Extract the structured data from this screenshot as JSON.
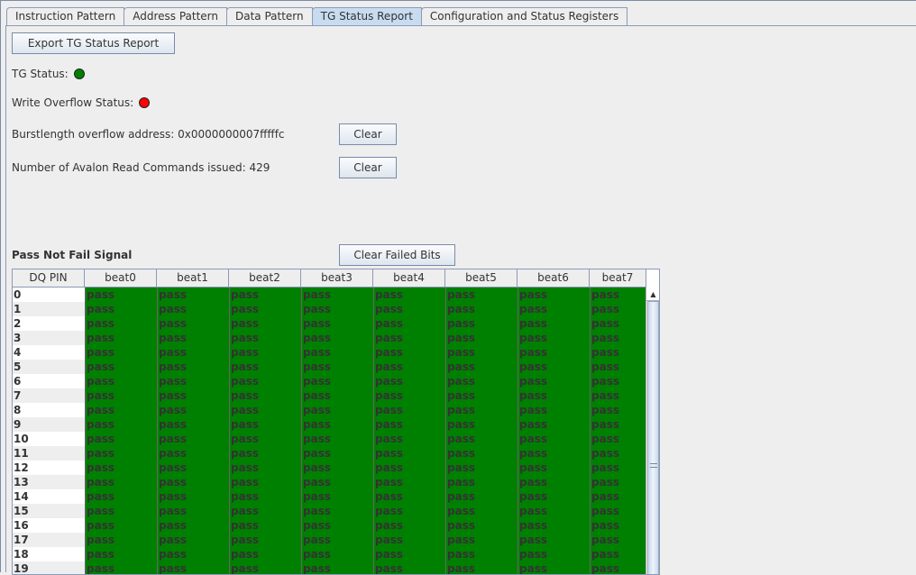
{
  "tabs": [
    {
      "label": "Instruction Pattern"
    },
    {
      "label": "Address Pattern"
    },
    {
      "label": "Data Pattern"
    },
    {
      "label": "TG Status Report",
      "active": true
    },
    {
      "label": "Configuration and Status Registers"
    }
  ],
  "export_button": "Export TG Status Report",
  "tg_status": {
    "label": "TG Status:",
    "color": "#008000"
  },
  "write_overflow": {
    "label": "Write Overflow Status:",
    "color": "#ff0000"
  },
  "burst_overflow": {
    "label": "Burstlength overflow address: 0x0000000007fffffc",
    "clear": "Clear"
  },
  "read_commands": {
    "label": "Number of Avalon Read Commands issued: 429",
    "clear": "Clear"
  },
  "pnf": {
    "title": "Pass Not Fail Signal",
    "clear_button": "Clear Failed Bits"
  },
  "table": {
    "columns": [
      "DQ PIN",
      "beat0",
      "beat1",
      "beat2",
      "beat3",
      "beat4",
      "beat5",
      "beat6",
      "beat7"
    ],
    "pass_color": "#008000",
    "rows": [
      {
        "pin": "0",
        "cells": [
          "pass",
          "pass",
          "pass",
          "pass",
          "pass",
          "pass",
          "pass",
          "pass"
        ]
      },
      {
        "pin": "1",
        "cells": [
          "pass",
          "pass",
          "pass",
          "pass",
          "pass",
          "pass",
          "pass",
          "pass"
        ]
      },
      {
        "pin": "2",
        "cells": [
          "pass",
          "pass",
          "pass",
          "pass",
          "pass",
          "pass",
          "pass",
          "pass"
        ]
      },
      {
        "pin": "3",
        "cells": [
          "pass",
          "pass",
          "pass",
          "pass",
          "pass",
          "pass",
          "pass",
          "pass"
        ]
      },
      {
        "pin": "4",
        "cells": [
          "pass",
          "pass",
          "pass",
          "pass",
          "pass",
          "pass",
          "pass",
          "pass"
        ]
      },
      {
        "pin": "5",
        "cells": [
          "pass",
          "pass",
          "pass",
          "pass",
          "pass",
          "pass",
          "pass",
          "pass"
        ]
      },
      {
        "pin": "6",
        "cells": [
          "pass",
          "pass",
          "pass",
          "pass",
          "pass",
          "pass",
          "pass",
          "pass"
        ]
      },
      {
        "pin": "7",
        "cells": [
          "pass",
          "pass",
          "pass",
          "pass",
          "pass",
          "pass",
          "pass",
          "pass"
        ]
      },
      {
        "pin": "8",
        "cells": [
          "pass",
          "pass",
          "pass",
          "pass",
          "pass",
          "pass",
          "pass",
          "pass"
        ]
      },
      {
        "pin": "9",
        "cells": [
          "pass",
          "pass",
          "pass",
          "pass",
          "pass",
          "pass",
          "pass",
          "pass"
        ]
      },
      {
        "pin": "10",
        "cells": [
          "pass",
          "pass",
          "pass",
          "pass",
          "pass",
          "pass",
          "pass",
          "pass"
        ]
      },
      {
        "pin": "11",
        "cells": [
          "pass",
          "pass",
          "pass",
          "pass",
          "pass",
          "pass",
          "pass",
          "pass"
        ]
      },
      {
        "pin": "12",
        "cells": [
          "pass",
          "pass",
          "pass",
          "pass",
          "pass",
          "pass",
          "pass",
          "pass"
        ]
      },
      {
        "pin": "13",
        "cells": [
          "pass",
          "pass",
          "pass",
          "pass",
          "pass",
          "pass",
          "pass",
          "pass"
        ]
      },
      {
        "pin": "14",
        "cells": [
          "pass",
          "pass",
          "pass",
          "pass",
          "pass",
          "pass",
          "pass",
          "pass"
        ]
      },
      {
        "pin": "15",
        "cells": [
          "pass",
          "pass",
          "pass",
          "pass",
          "pass",
          "pass",
          "pass",
          "pass"
        ]
      },
      {
        "pin": "16",
        "cells": [
          "pass",
          "pass",
          "pass",
          "pass",
          "pass",
          "pass",
          "pass",
          "pass"
        ]
      },
      {
        "pin": "17",
        "cells": [
          "pass",
          "pass",
          "pass",
          "pass",
          "pass",
          "pass",
          "pass",
          "pass"
        ]
      },
      {
        "pin": "18",
        "cells": [
          "pass",
          "pass",
          "pass",
          "pass",
          "pass",
          "pass",
          "pass",
          "pass"
        ]
      },
      {
        "pin": "19",
        "cells": [
          "pass",
          "pass",
          "pass",
          "pass",
          "pass",
          "pass",
          "pass",
          "pass"
        ]
      }
    ]
  }
}
